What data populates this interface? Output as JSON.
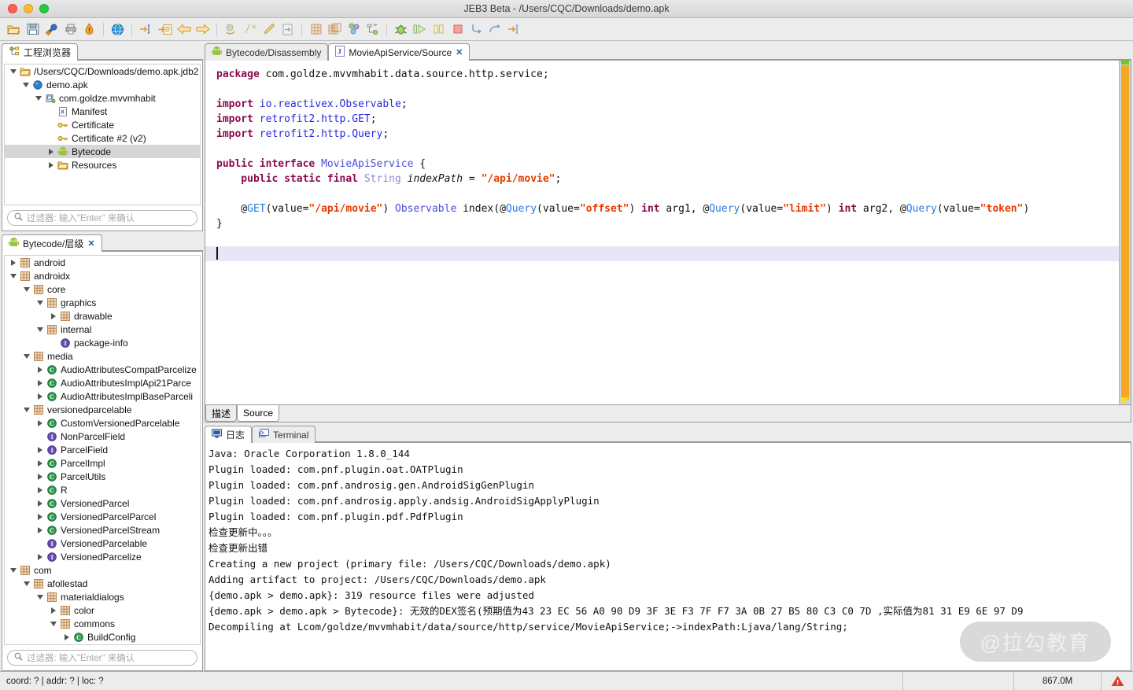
{
  "window": {
    "title": "JEB3 Beta - /Users/CQC/Downloads/demo.apk",
    "traffic": {
      "close": "close-window",
      "minimize": "minimize-window",
      "zoom": "zoom-window"
    }
  },
  "toolbar": {
    "items": [
      {
        "name": "open-folder-icon",
        "title": "Open"
      },
      {
        "name": "save-icon",
        "title": "Save"
      },
      {
        "name": "wrench-icon",
        "title": "Options"
      },
      {
        "name": "printer-icon",
        "title": "Print"
      },
      {
        "name": "warning-drop-icon",
        "title": "Alerts"
      },
      {
        "name": "globe-icon",
        "title": "Browser"
      },
      {
        "name": "goto-address-icon",
        "title": "Go to address"
      },
      {
        "name": "goto-doc-icon",
        "title": "Go to document"
      },
      {
        "name": "back-arrow-icon",
        "title": "Back"
      },
      {
        "name": "forward-arrow-icon",
        "title": "Forward"
      },
      {
        "name": "refactor-icon",
        "title": "Refactor"
      },
      {
        "name": "comment-icon",
        "title": "Comment"
      },
      {
        "name": "rename-pencil-icon",
        "title": "Rename"
      },
      {
        "name": "export-doc-icon",
        "title": "Export"
      },
      {
        "name": "grid-icon",
        "title": "Grid"
      },
      {
        "name": "grid-plus-icon",
        "title": "Grid plus"
      },
      {
        "name": "graph-nodes-icon",
        "title": "Graph"
      },
      {
        "name": "hierarchy-icon",
        "title": "Hierarchy"
      },
      {
        "name": "debug-bug-icon",
        "title": "Debug"
      },
      {
        "name": "run-icon",
        "title": "Run"
      },
      {
        "name": "pause-icon",
        "title": "Pause"
      },
      {
        "name": "stop-icon",
        "title": "Stop"
      },
      {
        "name": "step-into-icon",
        "title": "Step into"
      },
      {
        "name": "step-over-icon",
        "title": "Step over"
      },
      {
        "name": "step-out-icon",
        "title": "Step out"
      }
    ]
  },
  "project_explorer": {
    "tab_label": "工程浏览器",
    "tab_icon": "project-explorer-icon",
    "filter_placeholder": "过滤器: 输入\"Enter\" 来确认",
    "nodes": [
      {
        "label": "/Users/CQC/Downloads/demo.apk.jdb2",
        "indent": 1,
        "twisty": "down",
        "icon": "folder",
        "selected": false
      },
      {
        "label": "demo.apk",
        "indent": 2,
        "twisty": "down",
        "icon": "blue-sphere",
        "selected": false
      },
      {
        "label": "com.goldze.mvvmhabit",
        "indent": 3,
        "twisty": "down",
        "icon": "apk-package",
        "selected": false
      },
      {
        "label": "Manifest",
        "indent": 4,
        "twisty": "none",
        "icon": "xml",
        "selected": false
      },
      {
        "label": "Certificate",
        "indent": 4,
        "twisty": "none",
        "icon": "key",
        "selected": false
      },
      {
        "label": "Certificate #2 (v2)",
        "indent": 4,
        "twisty": "none",
        "icon": "key",
        "selected": false
      },
      {
        "label": "Bytecode",
        "indent": 4,
        "twisty": "right",
        "icon": "android",
        "selected": true
      },
      {
        "label": "Resources",
        "indent": 4,
        "twisty": "right",
        "icon": "folder",
        "selected": false
      }
    ]
  },
  "hierarchy_panel": {
    "tab_label": "Bytecode/层级",
    "tab_icon": "android-icon",
    "tab_close": "✕",
    "filter_placeholder": "过滤器: 输入\"Enter\" 来确认",
    "nodes": [
      {
        "label": "android",
        "indent": 1,
        "twisty": "right",
        "icon": "package"
      },
      {
        "label": "androidx",
        "indent": 1,
        "twisty": "down",
        "icon": "package"
      },
      {
        "label": "core",
        "indent": 2,
        "twisty": "down",
        "icon": "package"
      },
      {
        "label": "graphics",
        "indent": 3,
        "twisty": "down",
        "icon": "package"
      },
      {
        "label": "drawable",
        "indent": 4,
        "twisty": "right",
        "icon": "package"
      },
      {
        "label": "internal",
        "indent": 3,
        "twisty": "down",
        "icon": "package"
      },
      {
        "label": "package-info",
        "indent": 4,
        "twisty": "none",
        "icon": "interface"
      },
      {
        "label": "media",
        "indent": 2,
        "twisty": "down",
        "icon": "package"
      },
      {
        "label": "AudioAttributesCompatParcelize",
        "indent": 3,
        "twisty": "right",
        "icon": "class"
      },
      {
        "label": "AudioAttributesImplApi21Parce",
        "indent": 3,
        "twisty": "right",
        "icon": "class"
      },
      {
        "label": "AudioAttributesImplBaseParceli",
        "indent": 3,
        "twisty": "right",
        "icon": "class"
      },
      {
        "label": "versionedparcelable",
        "indent": 2,
        "twisty": "down",
        "icon": "package"
      },
      {
        "label": "CustomVersionedParcelable",
        "indent": 3,
        "twisty": "right",
        "icon": "class"
      },
      {
        "label": "NonParcelField",
        "indent": 3,
        "twisty": "none",
        "icon": "interface"
      },
      {
        "label": "ParcelField",
        "indent": 3,
        "twisty": "right",
        "icon": "interface"
      },
      {
        "label": "ParcelImpl",
        "indent": 3,
        "twisty": "right",
        "icon": "class"
      },
      {
        "label": "ParcelUtils",
        "indent": 3,
        "twisty": "right",
        "icon": "class"
      },
      {
        "label": "R",
        "indent": 3,
        "twisty": "right",
        "icon": "class"
      },
      {
        "label": "VersionedParcel",
        "indent": 3,
        "twisty": "right",
        "icon": "class"
      },
      {
        "label": "VersionedParcelParcel",
        "indent": 3,
        "twisty": "right",
        "icon": "class"
      },
      {
        "label": "VersionedParcelStream",
        "indent": 3,
        "twisty": "right",
        "icon": "class"
      },
      {
        "label": "VersionedParcelable",
        "indent": 3,
        "twisty": "none",
        "icon": "interface"
      },
      {
        "label": "VersionedParcelize",
        "indent": 3,
        "twisty": "right",
        "icon": "interface"
      },
      {
        "label": "com",
        "indent": 1,
        "twisty": "down",
        "icon": "package"
      },
      {
        "label": "afollestad",
        "indent": 2,
        "twisty": "down",
        "icon": "package"
      },
      {
        "label": "materialdialogs",
        "indent": 3,
        "twisty": "down",
        "icon": "package"
      },
      {
        "label": "color",
        "indent": 4,
        "twisty": "right",
        "icon": "package"
      },
      {
        "label": "commons",
        "indent": 4,
        "twisty": "down",
        "icon": "package"
      },
      {
        "label": "BuildConfig",
        "indent": 5,
        "twisty": "right",
        "icon": "class"
      }
    ]
  },
  "editor": {
    "tabs": [
      {
        "label": "Bytecode/Disassembly",
        "icon": "android-icon",
        "active": false,
        "closable": false
      },
      {
        "label": "MovieApiService/Source",
        "icon": "java-source-icon",
        "active": true,
        "closable": true,
        "close_glyph": "✕"
      }
    ],
    "sub_tabs": [
      {
        "label": "描述",
        "active": false
      },
      {
        "label": "Source",
        "active": true
      }
    ],
    "code_lines": [
      [
        {
          "t": "package ",
          "c": "kw"
        },
        {
          "t": "com.goldze.mvvmhabit.data.source.http.service;",
          "c": "plain"
        }
      ],
      [],
      [
        {
          "t": "import ",
          "c": "kw"
        },
        {
          "t": "io.reactivex.Observable",
          "c": "typ"
        },
        {
          "t": ";",
          "c": "plain"
        }
      ],
      [
        {
          "t": "import ",
          "c": "kw"
        },
        {
          "t": "retrofit2.http.GET",
          "c": "typ"
        },
        {
          "t": ";",
          "c": "plain"
        }
      ],
      [
        {
          "t": "import ",
          "c": "kw"
        },
        {
          "t": "retrofit2.http.Query",
          "c": "typ"
        },
        {
          "t": ";",
          "c": "plain"
        }
      ],
      [],
      [
        {
          "t": "public interface ",
          "c": "kw"
        },
        {
          "t": "MovieApiService",
          "c": "typ2"
        },
        {
          "t": " {",
          "c": "plain"
        }
      ],
      [
        {
          "t": "    public static final ",
          "c": "kw"
        },
        {
          "t": "String",
          "c": "lit"
        },
        {
          "t": " ",
          "c": "plain"
        },
        {
          "t": "indexPath",
          "c": "ital"
        },
        {
          "t": " = ",
          "c": "plain"
        },
        {
          "t": "\"/api/movie\"",
          "c": "str"
        },
        {
          "t": ";",
          "c": "plain"
        }
      ],
      [],
      [
        {
          "t": "    @",
          "c": "plain"
        },
        {
          "t": "GET",
          "c": "ann"
        },
        {
          "t": "(value=",
          "c": "plain"
        },
        {
          "t": "\"/api/movie\"",
          "c": "str"
        },
        {
          "t": ") ",
          "c": "plain"
        },
        {
          "t": "Observable",
          "c": "typ2"
        },
        {
          "t": " index(@",
          "c": "plain"
        },
        {
          "t": "Query",
          "c": "ann"
        },
        {
          "t": "(value=",
          "c": "plain"
        },
        {
          "t": "\"offset\"",
          "c": "str"
        },
        {
          "t": ") ",
          "c": "plain"
        },
        {
          "t": "int",
          "c": "kw"
        },
        {
          "t": " arg1, @",
          "c": "plain"
        },
        {
          "t": "Query",
          "c": "ann"
        },
        {
          "t": "(value=",
          "c": "plain"
        },
        {
          "t": "\"limit\"",
          "c": "str"
        },
        {
          "t": ") ",
          "c": "plain"
        },
        {
          "t": "int",
          "c": "kw"
        },
        {
          "t": " arg2, @",
          "c": "plain"
        },
        {
          "t": "Query",
          "c": "ann"
        },
        {
          "t": "(value=",
          "c": "plain"
        },
        {
          "t": "\"token\"",
          "c": "str"
        },
        {
          "t": ")",
          "c": "plain"
        }
      ],
      [
        {
          "t": "}",
          "c": "plain"
        }
      ],
      [],
      [
        {
          "caret": true
        }
      ]
    ],
    "scrollbar": {
      "thumb_color": "#f5a623",
      "top_marker_color": "#5bd516",
      "bottom_marker_color": "#f2e600"
    }
  },
  "log_panel": {
    "tabs": [
      {
        "label": "日志",
        "icon": "log-icon",
        "active": true
      },
      {
        "label": "Terminal",
        "icon": "terminal-icon",
        "active": false
      }
    ],
    "lines": [
      "Java: Oracle Corporation 1.8.0_144",
      "Plugin loaded: com.pnf.plugin.oat.OATPlugin",
      "Plugin loaded: com.pnf.androsig.gen.AndroidSigGenPlugin",
      "Plugin loaded: com.pnf.androsig.apply.andsig.AndroidSigApplyPlugin",
      "Plugin loaded: com.pnf.plugin.pdf.PdfPlugin",
      "检查更新中。。。",
      "检查更新出错",
      "Creating a new project (primary file: /Users/CQC/Downloads/demo.apk)",
      "Adding artifact to project: /Users/CQC/Downloads/demo.apk",
      "{demo.apk > demo.apk}: 319 resource files were adjusted",
      "{demo.apk > demo.apk > Bytecode}: 无效的DEX签名(预期值为43 23 EC 56 A0 90 D9 3F 3E F3 7F F7 3A 0B 27 B5 80 C3 C0 7D ,实际值为81 31 E9 6E 97 D9",
      "Decompiling at Lcom/goldze/mvvmhabit/data/source/http/service/MovieApiService;->indexPath:Ljava/lang/String;"
    ]
  },
  "status_bar": {
    "coord_text": "coord: ? | addr: ? | loc: ?",
    "memory": "867.0M",
    "warning_icon": "warning-triangle-icon"
  },
  "watermark": {
    "text": "@拉勾教育"
  },
  "colors": {
    "accent_orange": "#f5a623",
    "string_red": "#e63c00",
    "keyword_magenta": "#8b0a50",
    "type_blue": "#2a2ae0",
    "annotation_blue": "#2a7ae0",
    "selection_gray": "#d6d6d6",
    "caret_line": "#e6e6f7"
  }
}
